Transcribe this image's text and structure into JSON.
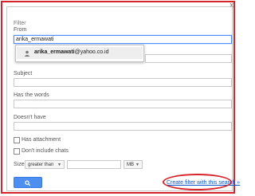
{
  "dialog": {
    "title": "Filter",
    "close_glyph": "x"
  },
  "from": {
    "label": "From",
    "value": "arika_ermawati"
  },
  "suggestion": {
    "bold_part": "arika_ermawati",
    "rest": "@yahoo.co.id",
    "icon": "person-icon"
  },
  "subject": {
    "label": "Subject",
    "value": ""
  },
  "has_words": {
    "label": "Has the words",
    "value": ""
  },
  "doesnt_have": {
    "label": "Doesn't have",
    "value": ""
  },
  "has_attachment": {
    "label": "Has attachment",
    "checked": false
  },
  "dont_include_chats": {
    "label": "Don't include chats",
    "checked": false
  },
  "size": {
    "label": "Size",
    "comparator": "greater than",
    "value": "",
    "unit": "MB"
  },
  "search_button": {
    "icon": "search-icon"
  },
  "create_filter_link": "Create filter with this search »",
  "colors": {
    "accent": "#4d8ff0",
    "link": "#1155cc",
    "highlight": "#d8232a"
  }
}
